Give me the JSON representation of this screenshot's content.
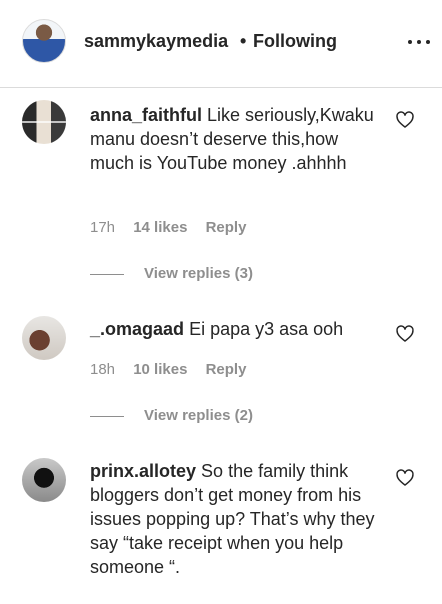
{
  "header": {
    "username": "sammykaymedia",
    "separator": "•",
    "follow_status": "Following",
    "avatar_icon": "profile-avatar",
    "more_icon": "more-horizontal-icon"
  },
  "comments": [
    {
      "username": "anna_faithful",
      "text": "Like seriously,Kwaku manu doesn’t deserve this,how much is YouTube money .ahhhh",
      "time": "17h",
      "likes": "14 likes",
      "reply": "Reply",
      "view_replies": "View replies (3)"
    },
    {
      "username": "_.omagaad",
      "text": "Ei papa y3 asa ooh",
      "time": "18h",
      "likes": "10 likes",
      "reply": "Reply",
      "view_replies": "View replies (2)"
    },
    {
      "username": "prinx.allotey",
      "text": "So the family think bloggers don’t get money from his issues popping up? That’s why they say “take receipt when you help someone “.",
      "time": "",
      "likes": "",
      "reply": "",
      "view_replies": ""
    }
  ],
  "colors": {
    "text": "#262626",
    "secondary": "#8e8e8e",
    "divider": "#dbdbdb"
  }
}
